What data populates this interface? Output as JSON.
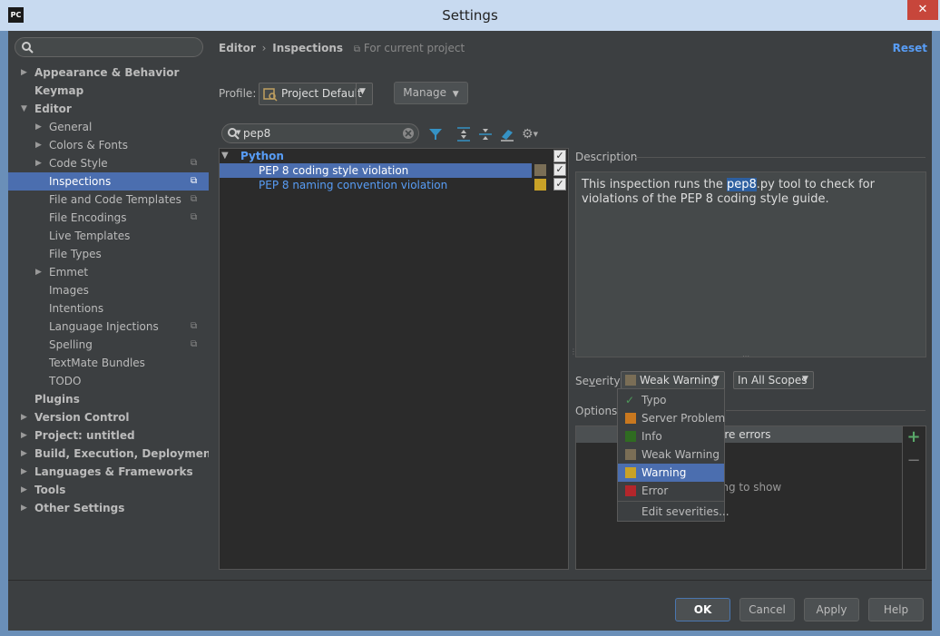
{
  "window": {
    "title": "Settings",
    "app_icon": "PC",
    "close_glyph": "✕"
  },
  "sidebar": {
    "search_value": "",
    "items": [
      {
        "label": "Appearance & Behavior",
        "arrow": "▶"
      },
      {
        "label": "Keymap",
        "arrow": ""
      },
      {
        "label": "Editor",
        "arrow": "▼"
      },
      {
        "label": "General",
        "arrow": "▶"
      },
      {
        "label": "Colors & Fonts",
        "arrow": "▶"
      },
      {
        "label": "Code Style",
        "arrow": "▶"
      },
      {
        "label": "Inspections",
        "arrow": ""
      },
      {
        "label": "File and Code Templates",
        "arrow": ""
      },
      {
        "label": "File Encodings",
        "arrow": ""
      },
      {
        "label": "Live Templates",
        "arrow": ""
      },
      {
        "label": "File Types",
        "arrow": ""
      },
      {
        "label": "Emmet",
        "arrow": "▶"
      },
      {
        "label": "Images",
        "arrow": ""
      },
      {
        "label": "Intentions",
        "arrow": ""
      },
      {
        "label": "Language Injections",
        "arrow": ""
      },
      {
        "label": "Spelling",
        "arrow": ""
      },
      {
        "label": "TextMate Bundles",
        "arrow": ""
      },
      {
        "label": "TODO",
        "arrow": ""
      },
      {
        "label": "Plugins",
        "arrow": ""
      },
      {
        "label": "Version Control",
        "arrow": "▶"
      },
      {
        "label": "Project: untitled",
        "arrow": "▶"
      },
      {
        "label": "Build, Execution, Deployment",
        "arrow": "▶"
      },
      {
        "label": "Languages & Frameworks",
        "arrow": "▶"
      },
      {
        "label": "Tools",
        "arrow": "▶"
      },
      {
        "label": "Other Settings",
        "arrow": "▶"
      }
    ]
  },
  "header": {
    "breadcrumb_1": "Editor",
    "separator": "›",
    "breadcrumb_2": "Inspections",
    "scope_note": "For current project",
    "reset": "Reset"
  },
  "profile": {
    "label": "Profile:",
    "value": "Project Default",
    "manage": "Manage"
  },
  "filter": {
    "search_value": "pep8"
  },
  "inspections": {
    "group": "Python",
    "items": [
      {
        "label": "PEP 8 coding style violation",
        "color": "#7a6e56"
      },
      {
        "label": "PEP 8 naming convention violation",
        "color": "#c9a227"
      }
    ]
  },
  "description": {
    "title": "Description",
    "text_before": "This inspection runs the ",
    "highlight": "pep8",
    "text_after": ".py tool to check for violations of the PEP 8 coding style guide."
  },
  "severity": {
    "label_prefix": "Se",
    "label_underlined": "v",
    "label_suffix": "erity:",
    "value": "Weak Warning",
    "scope": "In All Scopes"
  },
  "options": {
    "title": "Options",
    "header_partial": "ore errors",
    "empty_partial": "ing to show"
  },
  "severity_menu": {
    "items": [
      {
        "label": "Typo",
        "color": "#4e9a5a"
      },
      {
        "label": "Server Problem",
        "color": "#c9781f"
      },
      {
        "label": "Info",
        "color": "#2f6b21"
      },
      {
        "label": "Weak Warning",
        "color": "#7a6e56"
      },
      {
        "label": "Warning",
        "color": "#c9a227"
      },
      {
        "label": "Error",
        "color": "#b3262b"
      }
    ],
    "edit": "Edit severities..."
  },
  "footer": {
    "ok": "OK",
    "cancel": "Cancel",
    "apply": "Apply",
    "help": "Help"
  },
  "colors": {
    "accent": "#4b6eaf",
    "link": "#589df6",
    "background": "#3c3f41"
  }
}
